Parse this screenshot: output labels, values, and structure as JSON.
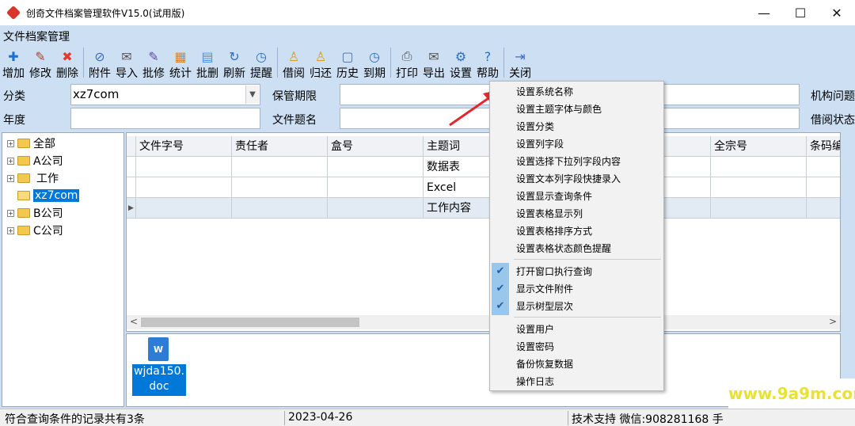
{
  "window": {
    "title": "创奇文件档案管理软件V15.0(试用版)",
    "minimize": "—",
    "maximize": "☐",
    "close": "✕"
  },
  "menu": {
    "title": "文件档案管理"
  },
  "toolbar": [
    {
      "label": "增加",
      "icon": "plus-icon",
      "glyph": "✚",
      "color": "#1e6fd1"
    },
    {
      "label": "修改",
      "icon": "pencil-icon",
      "glyph": "✎",
      "color": "#c0392b"
    },
    {
      "label": "删除",
      "icon": "delete-icon",
      "glyph": "✖",
      "color": "#e03a2f"
    },
    {
      "sep": true
    },
    {
      "label": "附件",
      "icon": "paperclip-icon",
      "glyph": "⊘",
      "color": "#3b6fc4"
    },
    {
      "label": "导入",
      "icon": "import-icon",
      "glyph": "✉",
      "color": "#555"
    },
    {
      "label": "批修",
      "icon": "batch-edit-icon",
      "glyph": "✎",
      "color": "#5e4aa8"
    },
    {
      "label": "统计",
      "icon": "stats-icon",
      "glyph": "▦",
      "color": "#d9822b"
    },
    {
      "label": "批删",
      "icon": "batch-delete-icon",
      "glyph": "▤",
      "color": "#4a90d9"
    },
    {
      "label": "刷新",
      "icon": "refresh-icon",
      "glyph": "↻",
      "color": "#2d6fb8"
    },
    {
      "label": "提醒",
      "icon": "clock-icon",
      "glyph": "◷",
      "color": "#2d6fb8"
    },
    {
      "sep": true
    },
    {
      "label": "借阅",
      "icon": "borrow-icon",
      "glyph": "♙",
      "color": "#d99a1e"
    },
    {
      "label": "归还",
      "icon": "return-icon",
      "glyph": "♙",
      "color": "#d99a1e"
    },
    {
      "label": "历史",
      "icon": "history-icon",
      "glyph": "▢",
      "color": "#4a6fa5"
    },
    {
      "label": "到期",
      "icon": "due-icon",
      "glyph": "◷",
      "color": "#2d6fb8"
    },
    {
      "sep": true
    },
    {
      "label": "打印",
      "icon": "printer-icon",
      "glyph": "⎙",
      "color": "#555"
    },
    {
      "label": "导出",
      "icon": "export-icon",
      "glyph": "✉",
      "color": "#555"
    },
    {
      "label": "设置",
      "icon": "gear-icon",
      "glyph": "⚙",
      "color": "#2d6fb8"
    },
    {
      "label": "帮助",
      "icon": "help-icon",
      "glyph": "?",
      "color": "#1e6fd1"
    },
    {
      "sep": true
    },
    {
      "label": "关闭",
      "icon": "exit-icon",
      "glyph": "⇥",
      "color": "#3b6fc4"
    }
  ],
  "filters": {
    "category_label": "分类",
    "category_value": "xz7com",
    "year_label": "年度",
    "retention_label": "保管期限",
    "doc_title_label": "文件题名",
    "org_label": "机构问题",
    "borrow_status_label": "借阅状态"
  },
  "tree": [
    {
      "label": "全部"
    },
    {
      "label": "A公司"
    },
    {
      "label": "工作"
    },
    {
      "label": "xz7com",
      "selected": true
    },
    {
      "label": "B公司"
    },
    {
      "label": "C公司"
    }
  ],
  "grid": {
    "columns": [
      "文件字号",
      "责任者",
      "盒号",
      "主题词",
      "",
      "",
      "全宗号",
      "条码编"
    ],
    "rows": [
      [
        "",
        "",
        "",
        "数据表",
        "",
        "",
        "",
        ""
      ],
      [
        "",
        "",
        "",
        "Excel",
        "",
        "",
        "",
        ""
      ],
      [
        "",
        "",
        "",
        "工作内容",
        "",
        "",
        "",
        ""
      ]
    ],
    "current_row_marker": "▶"
  },
  "attachment": {
    "filename": "wjda150.doc",
    "line1": "wjda150.",
    "line2": "doc",
    "icon_letter": "W"
  },
  "status": {
    "count": "符合查询条件的记录共有3条",
    "date": "2023-04-26",
    "support": "技术支持 微信:908281168 手"
  },
  "context_menu": {
    "items": [
      {
        "label": "设置系统名称"
      },
      {
        "label": "设置主题字体与颜色"
      },
      {
        "label": "设置分类"
      },
      {
        "label": "设置列字段"
      },
      {
        "label": "设置选择下拉列字段内容"
      },
      {
        "label": "设置文本列字段快捷录入"
      },
      {
        "label": "设置显示查询条件"
      },
      {
        "label": "设置表格显示列"
      },
      {
        "label": "设置表格排序方式"
      },
      {
        "label": "设置表格状态颜色提醒"
      },
      {
        "label": "打开窗口执行查询",
        "checked": true
      },
      {
        "label": "显示文件附件",
        "checked": true
      },
      {
        "label": "显示树型层次",
        "checked": true
      },
      {
        "label": "设置用户"
      },
      {
        "label": "设置密码"
      },
      {
        "label": "备份恢复数据"
      },
      {
        "label": "操作日志"
      }
    ]
  },
  "watermark": {
    "text": "www.9a9m.com"
  },
  "colors": {
    "accent": "#0078d7",
    "background": "#cde0f3",
    "arrow": "#e0282e"
  }
}
